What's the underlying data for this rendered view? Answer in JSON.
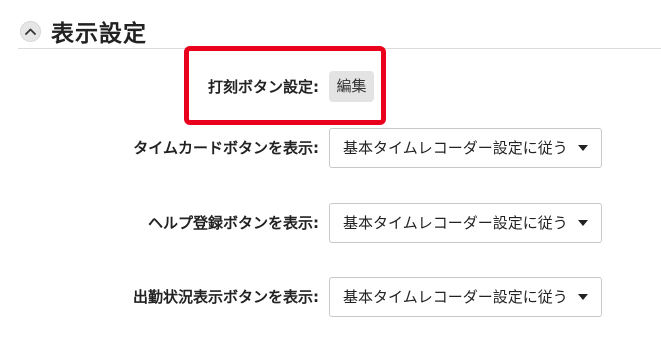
{
  "section": {
    "title": "表示設定",
    "collapse_icon": "chevron-up-icon"
  },
  "highlight_color": "#e8001c",
  "rows": [
    {
      "label": "打刻ボタン設定:",
      "control": "button",
      "button_label": "編集"
    },
    {
      "label": "タイムカードボタンを表示:",
      "control": "select",
      "value": "基本タイムレコーダー設定に従う"
    },
    {
      "label": "ヘルプ登録ボタンを表示:",
      "control": "select",
      "value": "基本タイムレコーダー設定に従う"
    },
    {
      "label": "出勤状況表示ボタンを表示:",
      "control": "select",
      "value": "基本タイムレコーダー設定に従う"
    }
  ]
}
